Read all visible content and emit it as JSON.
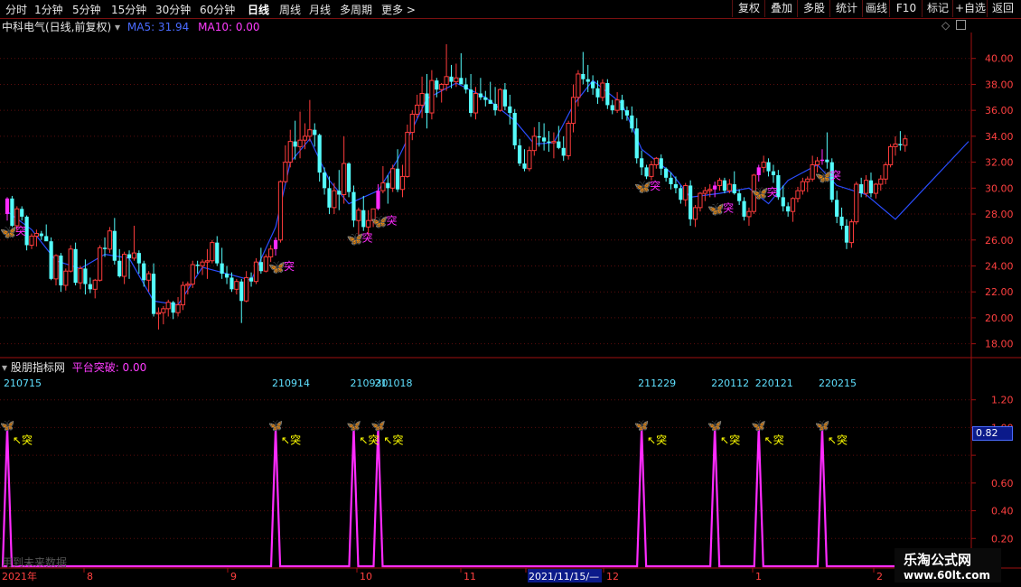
{
  "toolbar": {
    "periods": [
      "分时",
      "1分钟",
      "5分钟",
      "15分钟",
      "30分钟",
      "60分钟",
      "日线",
      "周线",
      "月线",
      "多周期",
      "更多 >"
    ],
    "active_period": "日线",
    "right_buttons": [
      "复权",
      "叠加",
      "多股",
      "统计",
      "画线",
      "F10",
      "标记",
      "+自选",
      "返回"
    ]
  },
  "main_panel": {
    "stock_title": "中科电气(日线,前复权)",
    "ma5_label": "MA5: 31.94",
    "ma10_label": "MA10: 0.00",
    "signal_char": "突"
  },
  "indicator_panel": {
    "name": "股朋指标网",
    "value_label": "平台突破: 0.00",
    "future_note": "用到未来数据",
    "current_value": "0.82"
  },
  "x_axis": {
    "labels": [
      "2021年",
      "8",
      "9",
      "10",
      "11",
      "2021/11/15/—",
      "12",
      "1",
      "2"
    ]
  },
  "watermark": {
    "line1": "乐淘公式网",
    "line2": "www.60lt.com"
  },
  "colors": {
    "up": "#ff3c3c",
    "down": "#54fcfc",
    "ma5": "#2a4dff",
    "signal": "#ff2bff",
    "axis": "#a01010",
    "grid": "#5a0d0d",
    "tick_text": "#ff4040"
  },
  "chart_data": [
    {
      "type": "candlestick",
      "title": "中科电气(日线,前复权)",
      "ylim": [
        17,
        42
      ],
      "yticks": [
        18.0,
        20.0,
        22.0,
        24.0,
        26.0,
        28.0,
        30.0,
        32.0,
        34.0,
        36.0,
        38.0,
        40.0
      ],
      "candles": [
        [
          28.0,
          29.3,
          27.5,
          29.2
        ],
        [
          29.2,
          29.4,
          27.0,
          27.1
        ],
        [
          27.1,
          28.6,
          26.6,
          28.4
        ],
        [
          28.4,
          28.6,
          27.5,
          27.8
        ],
        [
          27.8,
          27.9,
          25.2,
          25.6
        ],
        [
          25.6,
          26.5,
          25.3,
          26.3
        ],
        [
          26.3,
          26.8,
          25.5,
          26.5
        ],
        [
          26.5,
          26.7,
          26.0,
          26.3
        ],
        [
          26.3,
          27.2,
          26.0,
          25.9
        ],
        [
          25.9,
          26.2,
          22.9,
          23.0
        ],
        [
          23.0,
          24.9,
          22.5,
          24.8
        ],
        [
          24.8,
          25.0,
          22.0,
          22.5
        ],
        [
          22.5,
          23.8,
          22.1,
          23.6
        ],
        [
          23.6,
          25.6,
          23.5,
          25.3
        ],
        [
          25.3,
          25.8,
          22.5,
          22.7
        ],
        [
          22.7,
          24.0,
          22.2,
          23.8
        ],
        [
          23.8,
          24.5,
          21.8,
          22.6
        ],
        [
          22.6,
          23.1,
          21.9,
          22.2
        ],
        [
          22.2,
          23.0,
          21.5,
          22.9
        ],
        [
          22.9,
          25.6,
          22.8,
          25.4
        ],
        [
          25.4,
          26.2,
          24.7,
          25.3
        ],
        [
          25.3,
          27.0,
          25.0,
          26.7
        ],
        [
          26.7,
          27.7,
          24.1,
          24.4
        ],
        [
          24.4,
          25.3,
          23.1,
          23.2
        ],
        [
          23.2,
          25.1,
          22.6,
          24.9
        ],
        [
          24.9,
          25.2,
          23.0,
          24.6
        ],
        [
          24.6,
          27.1,
          24.4,
          25.0
        ],
        [
          25.0,
          25.2,
          23.4,
          24.2
        ],
        [
          24.2,
          24.4,
          22.4,
          22.9
        ],
        [
          22.9,
          23.6,
          22.0,
          23.4
        ],
        [
          23.4,
          24.2,
          20.1,
          20.3
        ],
        [
          20.3,
          20.8,
          19.1,
          20.4
        ],
        [
          20.4,
          20.9,
          19.5,
          20.7
        ],
        [
          20.7,
          21.4,
          20.1,
          21.2
        ],
        [
          21.2,
          21.3,
          19.9,
          20.4
        ],
        [
          20.4,
          21.6,
          20.1,
          21.0
        ],
        [
          21.0,
          22.8,
          20.6,
          22.5
        ],
        [
          22.5,
          22.8,
          21.8,
          22.6
        ],
        [
          22.6,
          24.4,
          22.3,
          24.1
        ],
        [
          24.1,
          24.4,
          23.4,
          24.0
        ],
        [
          24.0,
          24.5,
          23.3,
          24.3
        ],
        [
          24.3,
          25.3,
          23.0,
          24.4
        ],
        [
          24.4,
          26.0,
          24.2,
          25.8
        ],
        [
          25.8,
          26.3,
          24.0,
          24.2
        ],
        [
          24.2,
          25.4,
          23.0,
          23.4
        ],
        [
          23.4,
          24.0,
          22.6,
          23.1
        ],
        [
          23.1,
          23.5,
          22.0,
          22.2
        ],
        [
          22.2,
          23.0,
          21.8,
          22.8
        ],
        [
          22.8,
          23.0,
          19.6,
          21.3
        ],
        [
          21.3,
          23.6,
          21.2,
          23.1
        ],
        [
          23.1,
          23.5,
          22.4,
          22.8
        ],
        [
          22.8,
          24.6,
          22.6,
          24.3
        ],
        [
          24.3,
          25.4,
          23.4,
          23.6
        ],
        [
          23.6,
          24.9,
          23.5,
          24.7
        ],
        [
          24.7,
          25.6,
          24.3,
          25.3
        ],
        [
          25.3,
          26.2,
          24.8,
          26.0
        ],
        [
          26.0,
          30.6,
          25.8,
          30.5
        ],
        [
          30.5,
          33.3,
          30.4,
          32.0
        ],
        [
          32.0,
          34.5,
          31.6,
          33.6
        ],
        [
          33.6,
          35.2,
          32.2,
          33.2
        ],
        [
          33.2,
          35.9,
          32.3,
          33.7
        ],
        [
          33.7,
          35.0,
          33.0,
          34.0
        ],
        [
          34.0,
          36.8,
          33.6,
          34.5
        ],
        [
          34.5,
          35.0,
          33.2,
          34.1
        ],
        [
          34.1,
          34.2,
          30.5,
          31.2
        ],
        [
          31.2,
          31.6,
          29.5,
          30.0
        ],
        [
          30.0,
          30.9,
          28.0,
          28.5
        ],
        [
          28.5,
          30.4,
          28.0,
          29.8
        ],
        [
          29.8,
          31.4,
          28.3,
          29.5
        ],
        [
          29.5,
          34.0,
          28.8,
          31.9
        ],
        [
          31.9,
          32.0,
          29.3,
          29.7
        ],
        [
          29.7,
          30.2,
          27.0,
          27.5
        ],
        [
          27.5,
          28.5,
          26.2,
          28.3
        ],
        [
          28.3,
          29.4,
          26.7,
          27.0
        ],
        [
          27.0,
          28.3,
          26.3,
          27.5
        ],
        [
          27.5,
          28.4,
          27.0,
          28.4
        ],
        [
          28.4,
          30.3,
          28.3,
          29.8
        ],
        [
          29.8,
          31.7,
          29.6,
          30.4
        ],
        [
          30.4,
          31.0,
          28.8,
          30.0
        ],
        [
          30.0,
          31.8,
          29.7,
          31.5
        ],
        [
          31.5,
          33.0,
          29.7,
          29.9
        ],
        [
          29.9,
          31.8,
          29.3,
          30.9
        ],
        [
          30.9,
          34.9,
          30.8,
          34.3
        ],
        [
          34.3,
          36.0,
          33.7,
          35.7
        ],
        [
          35.7,
          37.2,
          35.4,
          36.4
        ],
        [
          36.4,
          38.6,
          35.4,
          37.3
        ],
        [
          37.3,
          38.8,
          34.6,
          35.8
        ],
        [
          35.8,
          39.1,
          35.3,
          38.3
        ],
        [
          38.3,
          38.5,
          37.0,
          37.6
        ],
        [
          37.6,
          38.1,
          36.6,
          38.0
        ],
        [
          38.0,
          41.1,
          37.5,
          38.6
        ],
        [
          38.6,
          39.5,
          37.7,
          38.2
        ],
        [
          38.2,
          39.6,
          37.8,
          38.5
        ],
        [
          38.5,
          40.4,
          38.1,
          38.0
        ],
        [
          38.0,
          38.5,
          37.3,
          37.6
        ],
        [
          37.6,
          38.8,
          35.5,
          35.8
        ],
        [
          35.8,
          37.8,
          35.3,
          37.3
        ],
        [
          37.3,
          38.5,
          36.8,
          37.0
        ],
        [
          37.0,
          37.5,
          36.3,
          36.8
        ],
        [
          36.8,
          38.2,
          36.5,
          36.5
        ],
        [
          36.5,
          37.8,
          35.6,
          36.0
        ],
        [
          36.0,
          37.7,
          35.9,
          37.6
        ],
        [
          37.6,
          38.1,
          36.0,
          36.3
        ],
        [
          36.3,
          37.2,
          34.9,
          35.8
        ],
        [
          35.8,
          36.1,
          33.0,
          33.3
        ],
        [
          33.3,
          33.8,
          31.7,
          31.9
        ],
        [
          31.9,
          33.0,
          31.3,
          31.5
        ],
        [
          31.5,
          33.2,
          31.3,
          32.9
        ],
        [
          32.9,
          34.7,
          32.5,
          34.0
        ],
        [
          34.0,
          35.1,
          33.2,
          33.9
        ],
        [
          33.9,
          35.0,
          32.9,
          33.6
        ],
        [
          33.6,
          34.4,
          32.8,
          33.5
        ],
        [
          33.5,
          34.3,
          32.3,
          33.6
        ],
        [
          33.6,
          34.8,
          33.0,
          33.1
        ],
        [
          33.1,
          34.0,
          32.1,
          32.5
        ],
        [
          32.5,
          35.2,
          32.2,
          35.0
        ],
        [
          35.0,
          38.0,
          34.3,
          37.0
        ],
        [
          37.0,
          39.1,
          36.3,
          38.8
        ],
        [
          38.8,
          40.5,
          38.0,
          38.4
        ],
        [
          38.4,
          39.5,
          37.4,
          38.2
        ],
        [
          38.2,
          38.7,
          37.2,
          37.7
        ],
        [
          37.7,
          38.3,
          36.5,
          37.0
        ],
        [
          37.0,
          38.4,
          36.7,
          38.1
        ],
        [
          38.1,
          38.4,
          36.1,
          36.4
        ],
        [
          36.4,
          36.8,
          35.7,
          36.0
        ],
        [
          36.0,
          37.4,
          35.8,
          36.8
        ],
        [
          36.8,
          37.2,
          35.3,
          36.0
        ],
        [
          36.0,
          36.3,
          35.2,
          35.6
        ],
        [
          35.6,
          36.3,
          34.3,
          34.6
        ],
        [
          34.6,
          35.4,
          31.9,
          32.3
        ],
        [
          32.3,
          32.9,
          31.0,
          31.6
        ],
        [
          31.6,
          31.8,
          30.7,
          30.9
        ],
        [
          30.9,
          32.1,
          30.6,
          31.8
        ],
        [
          31.8,
          32.4,
          31.5,
          32.3
        ],
        [
          32.3,
          32.6,
          31.0,
          31.5
        ],
        [
          31.5,
          31.6,
          30.5,
          30.8
        ],
        [
          30.8,
          31.2,
          29.9,
          30.3
        ],
        [
          30.3,
          30.9,
          29.6,
          30.0
        ],
        [
          30.0,
          30.2,
          28.8,
          29.1
        ],
        [
          29.1,
          30.4,
          28.6,
          30.2
        ],
        [
          30.2,
          30.6,
          27.1,
          27.6
        ],
        [
          27.6,
          28.7,
          27.0,
          28.5
        ],
        [
          28.5,
          29.7,
          28.2,
          29.6
        ],
        [
          29.6,
          30.1,
          29.0,
          29.8
        ],
        [
          29.8,
          30.3,
          29.3,
          29.9
        ],
        [
          29.9,
          30.5,
          29.3,
          30.2
        ],
        [
          30.2,
          30.8,
          29.8,
          30.6
        ],
        [
          30.6,
          30.8,
          29.6,
          29.8
        ],
        [
          29.8,
          30.7,
          29.6,
          30.3
        ],
        [
          30.3,
          31.3,
          29.5,
          29.6
        ],
        [
          29.6,
          29.9,
          28.7,
          29.0
        ],
        [
          29.0,
          29.3,
          27.5,
          27.8
        ],
        [
          27.8,
          28.5,
          27.1,
          28.2
        ],
        [
          28.2,
          31.1,
          28.0,
          31.0
        ],
        [
          31.0,
          31.8,
          30.5,
          31.6
        ],
        [
          31.6,
          32.5,
          31.2,
          32.0
        ],
        [
          32.0,
          32.3,
          30.9,
          31.3
        ],
        [
          31.3,
          31.8,
          30.4,
          31.0
        ],
        [
          31.0,
          31.4,
          29.1,
          29.3
        ],
        [
          29.3,
          30.2,
          28.2,
          28.6
        ],
        [
          28.6,
          28.9,
          27.8,
          28.2
        ],
        [
          28.2,
          29.3,
          27.4,
          29.2
        ],
        [
          29.2,
          30.1,
          28.9,
          29.8
        ],
        [
          29.8,
          30.8,
          29.5,
          30.5
        ],
        [
          30.5,
          30.9,
          29.7,
          30.7
        ],
        [
          30.7,
          32.5,
          30.5,
          31.8
        ],
        [
          31.8,
          32.4,
          31.2,
          32.1
        ],
        [
          32.1,
          33.0,
          31.8,
          32.2
        ],
        [
          32.2,
          34.3,
          31.5,
          32.0
        ],
        [
          32.0,
          32.3,
          28.9,
          29.1
        ],
        [
          29.1,
          29.8,
          27.3,
          27.8
        ],
        [
          27.8,
          28.5,
          26.8,
          27.1
        ],
        [
          27.1,
          27.6,
          25.3,
          25.8
        ],
        [
          25.8,
          27.6,
          25.4,
          27.4
        ],
        [
          27.4,
          30.5,
          27.2,
          30.3
        ],
        [
          30.3,
          30.8,
          29.3,
          29.6
        ],
        [
          29.6,
          31.0,
          29.3,
          30.6
        ],
        [
          30.6,
          31.2,
          29.3,
          29.6
        ],
        [
          29.6,
          30.4,
          29.2,
          30.3
        ],
        [
          30.3,
          31.0,
          29.8,
          30.7
        ],
        [
          30.7,
          32.0,
          30.3,
          31.8
        ],
        [
          31.8,
          33.4,
          31.6,
          33.2
        ],
        [
          33.2,
          34.0,
          32.5,
          33.4
        ],
        [
          33.4,
          34.4,
          32.9,
          33.3
        ],
        [
          33.3,
          34.1,
          32.8,
          33.8
        ]
      ],
      "ma5": [
        [
          0,
          28.2
        ],
        [
          5,
          26.8
        ],
        [
          10,
          24.4
        ],
        [
          15,
          23.8
        ],
        [
          20,
          24.9
        ],
        [
          25,
          24.6
        ],
        [
          30,
          21.3
        ],
        [
          35,
          21.0
        ],
        [
          40,
          23.9
        ],
        [
          45,
          23.4
        ],
        [
          50,
          22.9
        ],
        [
          55,
          27.0
        ],
        [
          58,
          32.0
        ],
        [
          62,
          33.8
        ],
        [
          66,
          30.6
        ],
        [
          70,
          28.8
        ],
        [
          76,
          29.8
        ],
        [
          80,
          32.2
        ],
        [
          86,
          36.9
        ],
        [
          92,
          38.1
        ],
        [
          98,
          37.0
        ],
        [
          104,
          35.2
        ],
        [
          108,
          33.4
        ],
        [
          112,
          33.5
        ],
        [
          116,
          36.4
        ],
        [
          120,
          38.3
        ],
        [
          126,
          36.5
        ],
        [
          130,
          33.0
        ],
        [
          136,
          31.2
        ],
        [
          140,
          29.3
        ],
        [
          146,
          29.6
        ],
        [
          152,
          30.0
        ],
        [
          156,
          28.8
        ],
        [
          160,
          30.6
        ],
        [
          166,
          31.8
        ],
        [
          170,
          30.2
        ],
        [
          176,
          29.5
        ],
        [
          182,
          27.6
        ],
        [
          188,
          30.0
        ],
        [
          194,
          32.4
        ],
        [
          197,
          33.6
        ]
      ],
      "signals": [
        0,
        55,
        71,
        76,
        130,
        145,
        154,
        167
      ],
      "last_index": 197
    },
    {
      "type": "line",
      "title": "平台突破",
      "ylim": [
        0,
        1.4
      ],
      "yticks": [
        0.2,
        0.4,
        0.6,
        0.8,
        1.0,
        1.2
      ],
      "spike_indices": [
        0,
        55,
        71,
        76,
        130,
        145,
        154,
        167
      ],
      "spike_dates": [
        "210715",
        "210914",
        "210930",
        "211018",
        "211229",
        "220112",
        "220121",
        "220215"
      ],
      "spike_value": 1.0,
      "base_value": 0.0
    }
  ]
}
